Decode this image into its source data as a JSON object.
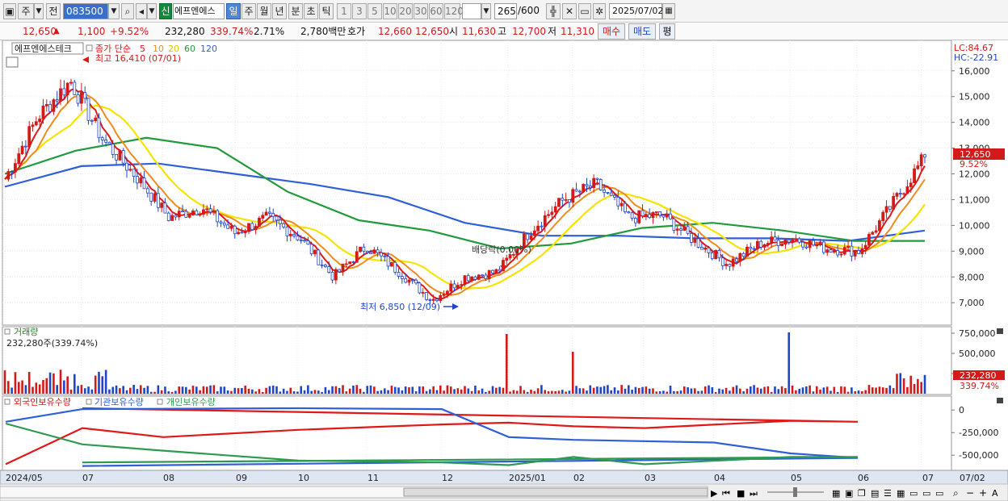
{
  "toolbar": {
    "market_label": "주",
    "prev_label": "전",
    "code": "083500",
    "new_badge": "신",
    "stock_name": "에프엔에스",
    "periods": [
      "일",
      "주",
      "월",
      "년",
      "분",
      "초",
      "틱"
    ],
    "active_period": "일",
    "intervals": [
      "1",
      "3",
      "5",
      "10",
      "20",
      "30",
      "60",
      "120"
    ],
    "count_value": "265",
    "count_total": "/600",
    "date": "2025/07/02"
  },
  "quote": {
    "price": "12,650",
    "change": "1,100",
    "change_pct": "+9.52%",
    "volume": "232,280",
    "volume_pct": "339.74%",
    "turnover_pct": "2.71%",
    "amount": "2,780백만",
    "ask_label": "호가",
    "ask": "12,660",
    "bid": "12,650",
    "open_label": "시",
    "open": "11,630",
    "high_label": "고",
    "high": "12,700",
    "low_label": "저",
    "low": "11,310",
    "buy_label": "매수",
    "sell_label": "매도",
    "eval_label": "평"
  },
  "price_panel": {
    "name_box": "에프엔에스테크",
    "ma_label": "종가 단순",
    "ma_periods": [
      "5",
      "10",
      "20",
      "60",
      "120"
    ],
    "high_note": "최고 16,410 (07/01)",
    "low_note": "최저 6,850 (12/09)",
    "dividend_note": "배당락(0.00%)",
    "lc": "LC:84.67",
    "hc": "HC:-22.91",
    "y_ticks": [
      "16,000",
      "15,000",
      "14,000",
      "13,000",
      "12,000",
      "11,000",
      "10,000",
      "9,000",
      "8,000",
      "7,000"
    ],
    "current_price": "12,650",
    "current_pct": "9.52%"
  },
  "volume_panel": {
    "title": "거래량",
    "info": "232,280주(339.74%)",
    "y_ticks": [
      "750,000",
      "500,000",
      "250,000"
    ],
    "current": "232,280",
    "current_pct": "339.74%"
  },
  "holding_panel": {
    "legend": [
      "외국인보유수량",
      "기관보유수량",
      "개인보유수량"
    ],
    "y_ticks": [
      "0",
      "-250,000",
      "-500,000"
    ]
  },
  "x_axis": {
    "labels": [
      "2024/05",
      "07",
      "08",
      "09",
      "10",
      "11",
      "12",
      "2025/01",
      "02",
      "03",
      "04",
      "05",
      "06",
      "07"
    ],
    "end_label": "07/02"
  },
  "colors": {
    "up": "#d21a1a",
    "down": "#1f45c8",
    "ma5": "#e01818",
    "ma10": "#f08c1e",
    "ma20": "#f5e400",
    "ma60": "#219a3c",
    "ma120": "#2f5fd6",
    "foreign": "#e01818",
    "institution": "#2f5fd6",
    "individual": "#2e9a50"
  },
  "chart_data": {
    "type": "candlestick",
    "x": [
      "2024/05",
      "07",
      "08",
      "09",
      "10",
      "11",
      "12",
      "2025/01",
      "02",
      "03",
      "04",
      "05",
      "06",
      "07"
    ],
    "y_range_price": [
      6500,
      16800
    ],
    "close_series": [
      {
        "x": "2024/05",
        "y": 11800
      },
      {
        "x": "2024/06",
        "y": 14200
      },
      {
        "x": "07",
        "y": 15600
      },
      {
        "x": "2024/07 end",
        "y": 13300
      },
      {
        "x": "08",
        "y": 11900
      },
      {
        "x": "2024/08 mid",
        "y": 10300
      },
      {
        "x": "09",
        "y": 10700
      },
      {
        "x": "2024/09 mid",
        "y": 9700
      },
      {
        "x": "10",
        "y": 10300
      },
      {
        "x": "11",
        "y": 9500
      },
      {
        "x": "2024/11 mid",
        "y": 8000
      },
      {
        "x": "2024/11 end",
        "y": 9200
      },
      {
        "x": "12",
        "y": 8200
      },
      {
        "x": "2024/12 mid",
        "y": 7100
      },
      {
        "x": "2024/12 end",
        "y": 8000
      },
      {
        "x": "2025/01",
        "y": 8200
      },
      {
        "x": "2025/01 mid",
        "y": 9800
      },
      {
        "x": "02",
        "y": 11000
      },
      {
        "x": "2025/02 mid",
        "y": 11600
      },
      {
        "x": "03",
        "y": 10300
      },
      {
        "x": "2025/03 mid",
        "y": 10400
      },
      {
        "x": "04",
        "y": 9400
      },
      {
        "x": "2025/04 mid",
        "y": 8500
      },
      {
        "x": "05",
        "y": 9300
      },
      {
        "x": "2025/05 mid",
        "y": 9500
      },
      {
        "x": "06",
        "y": 9100
      },
      {
        "x": "2025/06 mid",
        "y": 9000
      },
      {
        "x": "2025/06 end",
        "y": 10800
      },
      {
        "x": "07/02",
        "y": 12650
      }
    ],
    "ma120": [
      {
        "x": "2024/05",
        "y": 11500
      },
      {
        "x": "08",
        "y": 12300
      },
      {
        "x": "09",
        "y": 12400
      },
      {
        "x": "10",
        "y": 12000
      },
      {
        "x": "11",
        "y": 11600
      },
      {
        "x": "12",
        "y": 11100
      },
      {
        "x": "2025/01",
        "y": 10100
      },
      {
        "x": "02",
        "y": 9600
      },
      {
        "x": "03",
        "y": 9600
      },
      {
        "x": "04",
        "y": 9500
      },
      {
        "x": "05",
        "y": 9500
      },
      {
        "x": "06",
        "y": 9400
      },
      {
        "x": "07",
        "y": 9800
      }
    ],
    "ma60": [
      {
        "x": "2024/05",
        "y": 12000
      },
      {
        "x": "07",
        "y": 12900
      },
      {
        "x": "08",
        "y": 13400
      },
      {
        "x": "09",
        "y": 13000
      },
      {
        "x": "10",
        "y": 11300
      },
      {
        "x": "11",
        "y": 10200
      },
      {
        "x": "12",
        "y": 9800
      },
      {
        "x": "2025/01",
        "y": 9100
      },
      {
        "x": "02",
        "y": 9300
      },
      {
        "x": "03",
        "y": 9900
      },
      {
        "x": "04",
        "y": 10100
      },
      {
        "x": "05",
        "y": 9800
      },
      {
        "x": "06",
        "y": 9400
      },
      {
        "x": "07",
        "y": 9400
      }
    ],
    "volume_markers": [
      {
        "x": "2025/01",
        "y": 740000
      },
      {
        "x": "02",
        "y": 520000
      },
      {
        "x": "05",
        "y": 760000
      },
      {
        "x": "07/02",
        "y": 232280
      }
    ],
    "volume_range": [
      0,
      800000
    ],
    "holdings": {
      "y_range": [
        -650000,
        100000
      ],
      "series": [
        {
          "name": "외국인보유수량",
          "points": [
            {
              "x": "2024/05",
              "y": -600000
            },
            {
              "x": "07",
              "y": -200000
            },
            {
              "x": "08",
              "y": -300000
            },
            {
              "x": "10",
              "y": -220000
            },
            {
              "x": "12",
              "y": -160000
            },
            {
              "x": "2025/01",
              "y": -140000
            },
            {
              "x": "02",
              "y": -180000
            },
            {
              "x": "03",
              "y": -200000
            },
            {
              "x": "05",
              "y": -120000
            },
            {
              "x": "06",
              "y": -130000
            },
            {
              "x": "07",
              "y": 20000
            }
          ]
        },
        {
          "name": "기관보유수량",
          "points": [
            {
              "x": "2024/05",
              "y": -130000
            },
            {
              "x": "07",
              "y": 10000
            },
            {
              "x": "10",
              "y": 20000
            },
            {
              "x": "12",
              "y": 10000
            },
            {
              "x": "2025/01",
              "y": -300000
            },
            {
              "x": "02",
              "y": -330000
            },
            {
              "x": "04",
              "y": -360000
            },
            {
              "x": "05",
              "y": -480000
            },
            {
              "x": "06",
              "y": -530000
            },
            {
              "x": "07",
              "y": -620000
            }
          ]
        },
        {
          "name": "개인보유수량",
          "points": [
            {
              "x": "2024/05",
              "y": -150000
            },
            {
              "x": "07",
              "y": -380000
            },
            {
              "x": "08",
              "y": -450000
            },
            {
              "x": "10",
              "y": -560000
            },
            {
              "x": "12",
              "y": -580000
            },
            {
              "x": "2025/01",
              "y": -610000
            },
            {
              "x": "02",
              "y": -520000
            },
            {
              "x": "03",
              "y": -600000
            },
            {
              "x": "05",
              "y": -520000
            },
            {
              "x": "06",
              "y": -520000
            },
            {
              "x": "07",
              "y": -580000
            }
          ]
        }
      ]
    }
  }
}
